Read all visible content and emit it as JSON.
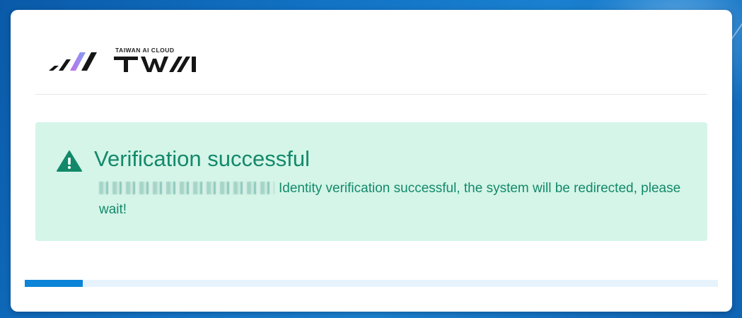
{
  "brand": {
    "name": "TWAI",
    "tagline": "TAIWAN AI CLOUD"
  },
  "alert": {
    "icon": "warning-triangle-icon",
    "title": "Verification successful",
    "redacted_identity": "",
    "message": "Identity verification successful, the system will be redirected, please wait!"
  },
  "progress": {
    "fraction": 0.084
  },
  "colors": {
    "background": "#1272c4",
    "alert_bg": "#d4f5e8",
    "alert_text": "#14896a",
    "progress_fill": "#0c84d8",
    "progress_track": "#e6f3fd"
  }
}
